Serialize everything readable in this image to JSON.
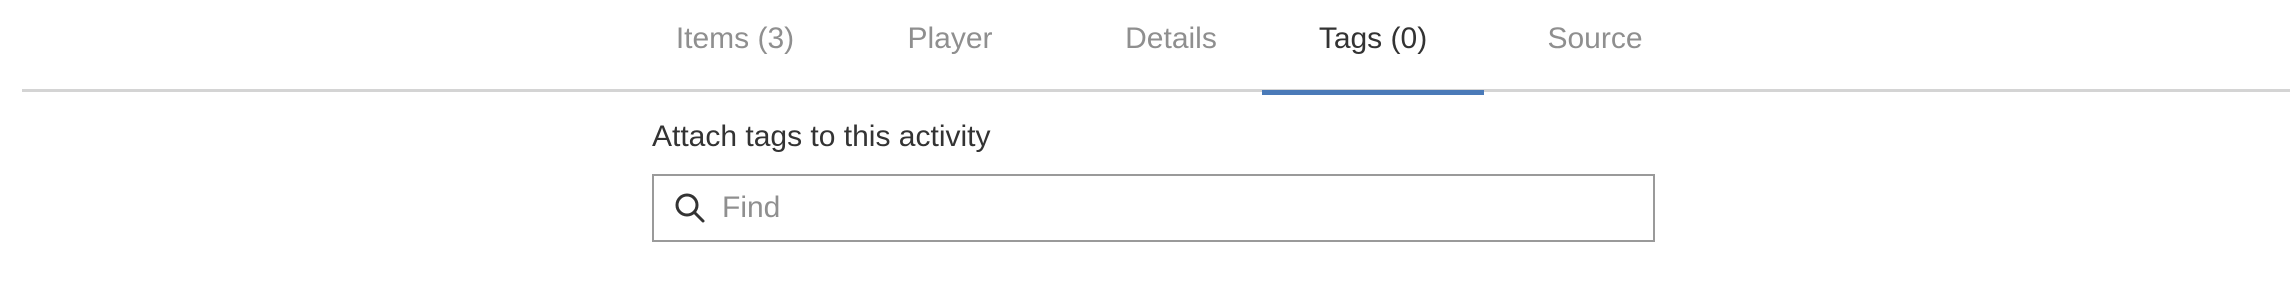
{
  "tabs": [
    {
      "label": "Items (3)",
      "active": false
    },
    {
      "label": "Player",
      "active": false
    },
    {
      "label": "Details",
      "active": false
    },
    {
      "label": "Tags (0)",
      "active": true
    },
    {
      "label": "Source",
      "active": false
    }
  ],
  "tags_panel": {
    "heading": "Attach tags to this activity",
    "search": {
      "placeholder": "Find",
      "value": "",
      "icon": "search-icon"
    }
  },
  "colors": {
    "active_tab_underline": "#4a7ab8",
    "active_tab_text": "#333333",
    "inactive_tab_text": "#8f8f8f",
    "divider": "#d4d4d4",
    "input_border": "#9a9a9a"
  }
}
